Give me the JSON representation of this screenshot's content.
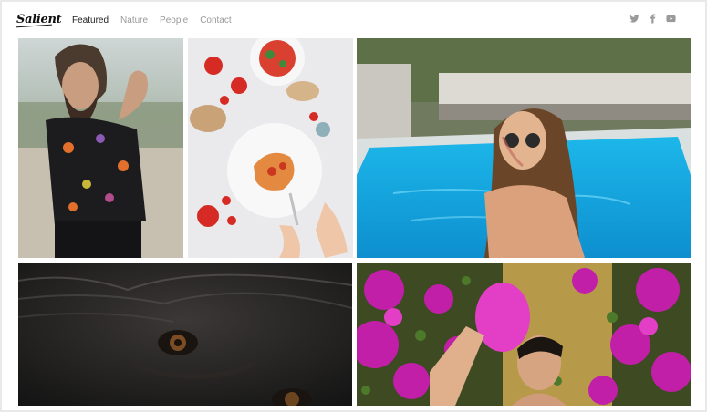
{
  "brand": {
    "logo_text": "Salient"
  },
  "nav": {
    "items": [
      {
        "label": "Featured",
        "active": true
      },
      {
        "label": "Nature",
        "active": false
      },
      {
        "label": "People",
        "active": false
      },
      {
        "label": "Contact",
        "active": false
      }
    ]
  },
  "social": {
    "icons": [
      "twitter-icon",
      "facebook-icon",
      "youtube-icon"
    ]
  },
  "gallery": {
    "images": [
      "man-with-beard-photo",
      "pasta-and-tomatoes-photo",
      "woman-in-pool-photo",
      "gorilla-closeup-photo",
      "man-with-flowers-photo"
    ]
  },
  "colors": {
    "nav_active": "#222222",
    "nav_inactive": "#9a9a9a",
    "pool": "#1aa3e0",
    "flowers": "#c21fa8"
  }
}
